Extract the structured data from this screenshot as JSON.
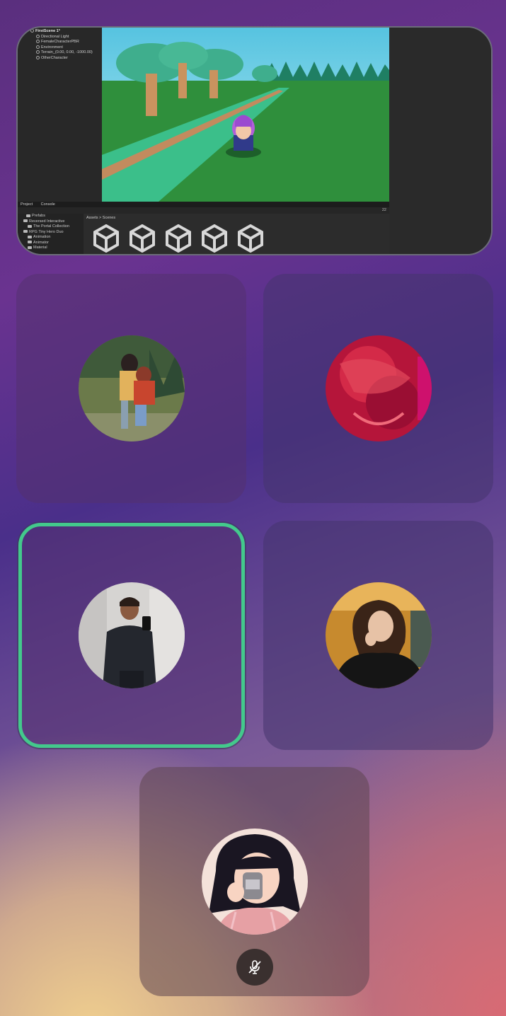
{
  "screen_share": {
    "hierarchy_items": [
      "FirstScene 1*",
      "Directional Light",
      "FemaleCharacterPBR",
      "Environment",
      "Terrain_(0.00, 0.00, -1000.00)",
      "OtherCharacter"
    ],
    "tabs": [
      "Project",
      "Console"
    ],
    "project_tree": [
      "Prefabs",
      "Reversed Interactive",
      "The Portal Collection",
      "RPG Tiny Hero Duo",
      "Animation",
      "Animator",
      "Material"
    ],
    "breadcrumb": "Assets > Scenes",
    "asset_count": "22",
    "asset_icons": [
      "unity-scene-icon",
      "unity-scene-icon",
      "unity-scene-icon",
      "unity-scene-icon",
      "unity-scene-icon"
    ]
  },
  "participants": [
    {
      "id": "p1",
      "avatar": "anime-couple-avatar",
      "speaking": false
    },
    {
      "id": "p2",
      "avatar": "red-abstract-avatar",
      "speaking": false
    },
    {
      "id": "p3",
      "avatar": "mirror-selfie-avatar",
      "speaking": true,
      "highlight_color": "#43c98c"
    },
    {
      "id": "p4",
      "avatar": "webcam-avatar",
      "speaking": false
    },
    {
      "id": "p5",
      "avatar": "anime-drinking-avatar",
      "speaking": false,
      "muted": true,
      "mute_icon": "mic-off-icon"
    }
  ]
}
